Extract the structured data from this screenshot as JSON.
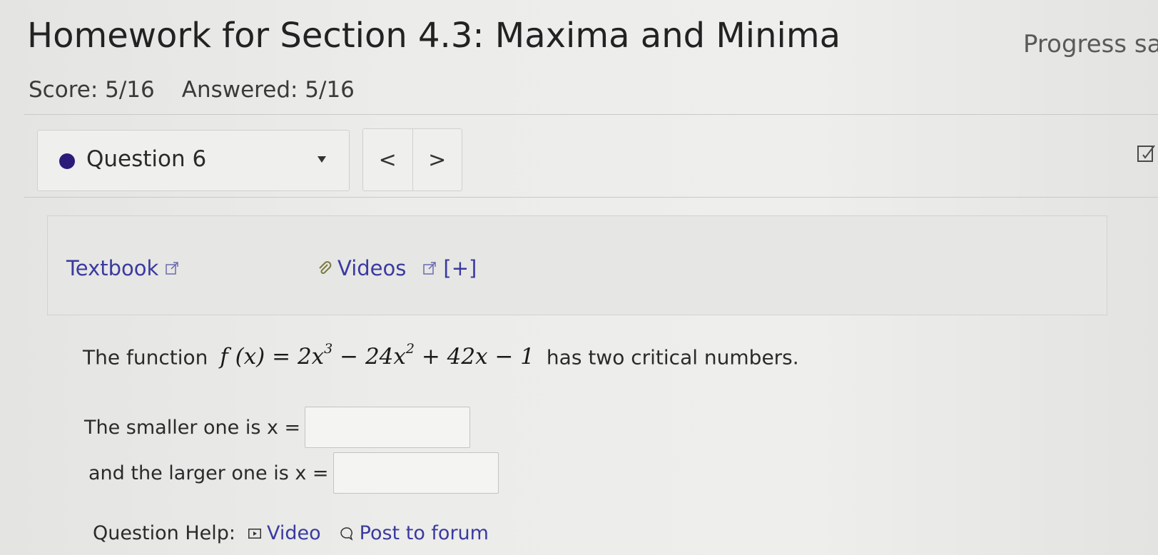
{
  "page": {
    "title": "Homework for Section 4.3: Maxima and Minima",
    "progress_status": "Progress sa"
  },
  "score": {
    "score_text": "Score: 5/16",
    "answered_text": "Answered: 5/16"
  },
  "question_nav": {
    "selected_label": "Question 6",
    "prev_label": "<",
    "next_label": ">"
  },
  "resources": {
    "textbook_label": "Textbook",
    "videos_label": "Videos",
    "videos_expand": "[+]"
  },
  "question": {
    "prefix": "The function",
    "function_lhs": "f (x) = ",
    "function_rhs": "has two critical numbers.",
    "smaller_label": "The smaller one is x =",
    "larger_label": "and the larger one is x =",
    "smaller_value": "",
    "larger_value": ""
  },
  "help": {
    "label": "Question Help:",
    "video_label": "Video",
    "forum_label": "Post to forum"
  },
  "colors": {
    "link": "#3a3aa0",
    "status_dot": "#2c1a7a"
  },
  "icons": [
    "external-link-icon",
    "paperclip-icon",
    "edit-icon",
    "play-icon",
    "chat-icon",
    "caret-down-icon"
  ]
}
